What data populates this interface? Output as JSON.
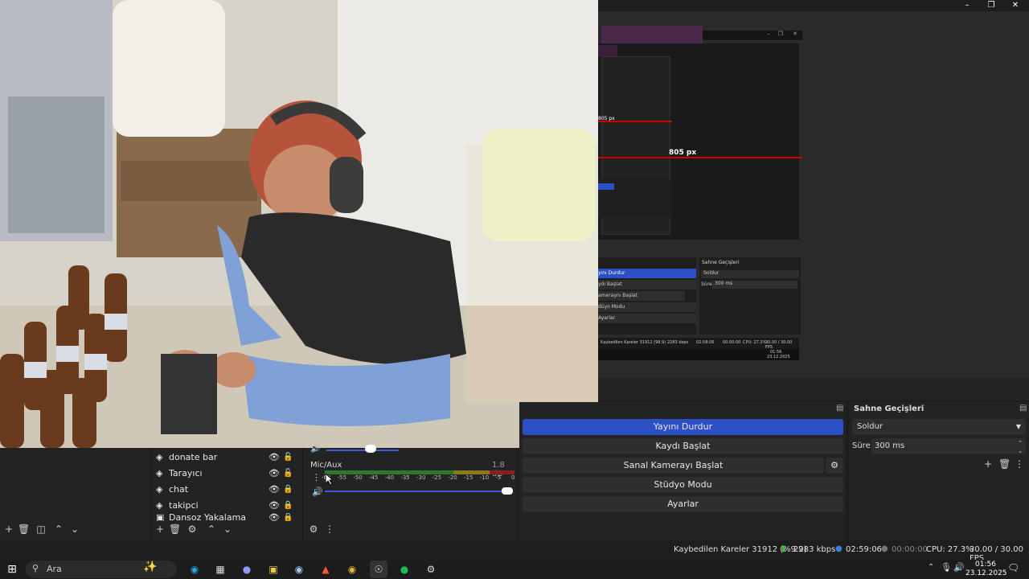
{
  "window": {
    "minimize_icon": "minimize-icon",
    "maximize_icon": "maximize-icon",
    "close_icon": "close-icon"
  },
  "preview_overlay": {
    "measure_label": "805 px",
    "measure_label_small": "805 px",
    "nested_controls": [
      "yını Durdur",
      "ydı Başlat",
      "ameraynı Başlat",
      "düyo Modu",
      "Ayarlar"
    ],
    "nested_transitions_title": "Sahne Geçişleri",
    "nested_transition": "Soldur",
    "nested_duration_label": "Süre",
    "nested_duration": "300 ms",
    "nested_status": "Kaybedilen Kareler 31912 (98.9)",
    "nested_kbps": "2283 kbps",
    "nested_time": "02:58:06",
    "nested_rec": "00:00:00",
    "nested_cpu": "CPU: 27.3%",
    "nested_fps": "30.00 / 30.00 FPS",
    "nested_clock": "01:56",
    "nested_date": "23.12.2025"
  },
  "sources": {
    "items": [
      {
        "label": "donate bar",
        "visible_icon": "eye-icon",
        "lock_icon": "unlock-icon"
      },
      {
        "label": "Tarayıcı",
        "visible_icon": "eye-icon",
        "lock_icon": "unlock-icon"
      },
      {
        "label": "chat",
        "visible_icon": "eye-icon",
        "lock_icon": "lock-icon"
      },
      {
        "label": "takipci",
        "visible_icon": "eye-icon",
        "lock_icon": "lock-icon"
      },
      {
        "label": "Dansoz Yakalama",
        "visible_icon": "eye-icon",
        "lock_icon": "lock-icon"
      }
    ]
  },
  "mixer": {
    "channel_name": "Mic/Aux",
    "channel_level": "1.8 dB",
    "scale": [
      "-60",
      "-55",
      "-50",
      "-45",
      "-40",
      "-35",
      "-30",
      "-25",
      "-20",
      "-15",
      "-10",
      "-5",
      "0"
    ],
    "volume": 1.0
  },
  "controls": {
    "stop_stream": "Yayını Durdur",
    "start_recording": "Kaydı Başlat",
    "start_virtual_camera": "Sanal Kamerayı Başlat",
    "studio_mode": "Stüdyo Modu",
    "settings": "Ayarlar"
  },
  "transitions": {
    "title": "Sahne Geçişleri",
    "selected": "Soldur",
    "duration_label": "Süre",
    "duration_value": "300 ms"
  },
  "status": {
    "dropped_frames": "Kaybedilen Kareler 31912 (%9.9)",
    "bitrate": "2283 kbps",
    "stream_time": "02:59:06",
    "record_time": "00:00:00",
    "cpu": "CPU: 27.3%",
    "fps": "30.00 / 30.00 FPS"
  },
  "taskbar": {
    "search_placeholder": "Ara",
    "clock_time": "01:56",
    "clock_date": "23.12.2025",
    "apps": [
      "edge-icon",
      "store-icon",
      "discord-icon",
      "files-icon",
      "steam-icon",
      "brave-icon",
      "chrome-icon",
      "obs-icon",
      "spotify-icon",
      "settings-icon"
    ]
  },
  "colors": {
    "accent": "#2c4fc6",
    "red_line": "#cc0000",
    "purple_bar": "#4a2a4a"
  }
}
